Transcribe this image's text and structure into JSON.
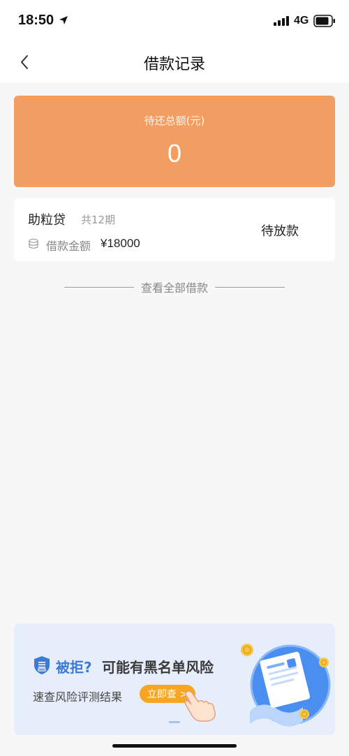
{
  "status_bar": {
    "time": "18:50",
    "network": "4G"
  },
  "nav": {
    "title": "借款记录"
  },
  "summary": {
    "label": "待还总额(元)",
    "amount": "0"
  },
  "loan": {
    "name": "助粒贷",
    "term": "共12期",
    "amount_label": "借款金额",
    "amount_value": "¥18000",
    "status": "待放款"
  },
  "view_all": {
    "label": "查看全部借款"
  },
  "promo": {
    "reject_text": "被拒?",
    "headline": "可能有黑名单风险",
    "subtitle": "速查风险评测结果",
    "button_label": "立即查 >"
  },
  "colors": {
    "accent_orange": "#f29e63",
    "promo_blue": "#3a7bd5",
    "promo_button": "#f6a623",
    "background": "#f7f7f7"
  }
}
